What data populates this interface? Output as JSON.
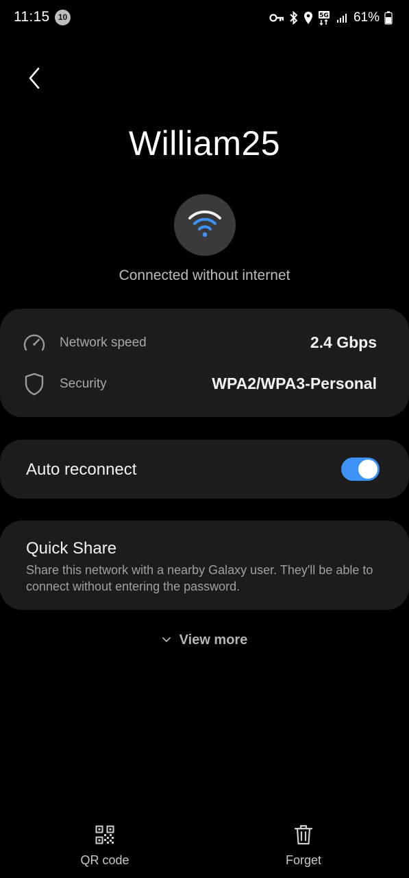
{
  "status_bar": {
    "time": "11:15",
    "notification_count": "10",
    "battery": "61%",
    "icons": [
      "vpn-key-icon",
      "bluetooth-icon",
      "location-icon",
      "5g-icon",
      "signal-icon",
      "battery-icon"
    ]
  },
  "header": {
    "back_icon": "chevron-left-icon",
    "network_name": "William25"
  },
  "wifi": {
    "icon": "wifi-icon",
    "status": "Connected without internet",
    "accent_color": "#3e91f5"
  },
  "info": {
    "rows": [
      {
        "icon": "speedometer-icon",
        "label": "Network speed",
        "value": "2.4 Gbps"
      },
      {
        "icon": "shield-icon",
        "label": "Security",
        "value": "WPA2/WPA3-Personal"
      }
    ]
  },
  "auto_reconnect": {
    "label": "Auto reconnect",
    "enabled": true
  },
  "quick_share": {
    "title": "Quick Share",
    "description": "Share this network with a nearby Galaxy user. They'll be able to connect without entering the password."
  },
  "view_more": {
    "icon": "chevron-down-icon",
    "label": "View more"
  },
  "bottom_actions": [
    {
      "icon": "qr-code-icon",
      "label": "QR code"
    },
    {
      "icon": "trash-icon",
      "label": "Forget"
    }
  ]
}
